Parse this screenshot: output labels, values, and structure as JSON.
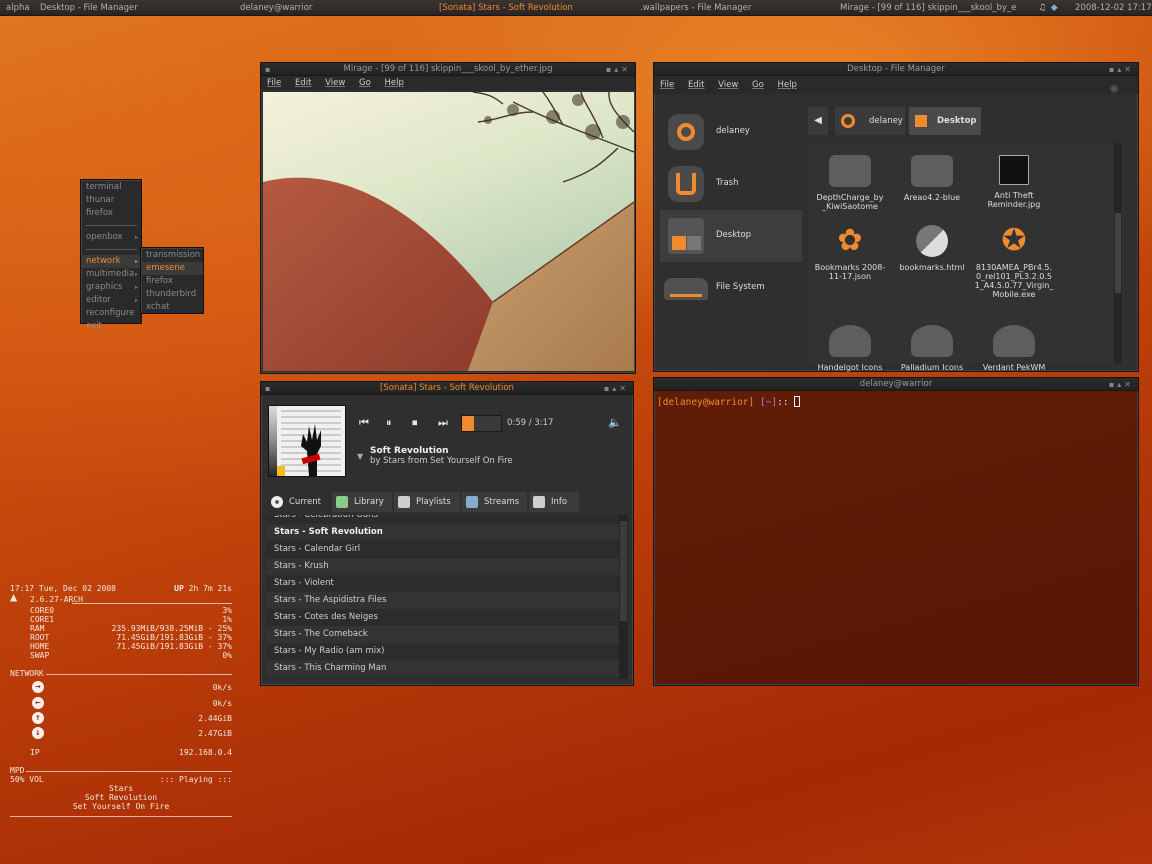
{
  "top_panel": {
    "desktop_name": "alpha",
    "tasks": [
      "Desktop - File Manager",
      "delaney@warrior",
      "[Sonata] Stars - Soft Revolution",
      ".wallpapers - File Manager",
      "Mirage - [99 of 116] skippin___skool_by_e"
    ],
    "active_task_index": 2,
    "tray_icons": [
      "music-note-icon",
      "network-icon"
    ],
    "clock": "2008-12-02 17:17"
  },
  "openbox_menu": {
    "items": [
      {
        "label": "terminal",
        "submenu": false
      },
      {
        "label": "thunar",
        "submenu": false
      },
      {
        "label": "firefox",
        "submenu": false
      },
      {
        "label": "openbox",
        "submenu": true
      },
      {
        "label": "network",
        "submenu": true
      },
      {
        "label": "multimedia",
        "submenu": true
      },
      {
        "label": "graphics",
        "submenu": true
      },
      {
        "label": "editor",
        "submenu": true
      },
      {
        "label": "reconfigure",
        "submenu": false
      },
      {
        "label": "exit",
        "submenu": false
      }
    ],
    "highlighted": "network",
    "submenu": {
      "items": [
        "transmission",
        "emesene",
        "firefox",
        "thunderbird",
        "xchat"
      ],
      "highlighted": "emesene"
    }
  },
  "mirage": {
    "title": "Mirage - [99 of 116] skippin___skool_by_ether.jpg",
    "menu": [
      "File",
      "Edit",
      "View",
      "Go",
      "Help"
    ]
  },
  "file_manager": {
    "title": "Desktop - File Manager",
    "menu": [
      "File",
      "Edit",
      "View",
      "Go",
      "Help"
    ],
    "sidebar": [
      "delaney",
      "Trash",
      "Desktop",
      "File System"
    ],
    "sidebar_selected": "Desktop",
    "breadcrumb": [
      "delaney",
      "Desktop"
    ],
    "files": [
      {
        "name": "DepthCharge_by _KiwiSaotome",
        "icon": "folder-icon"
      },
      {
        "name": "Areao4.2-blue",
        "icon": "folder-icon"
      },
      {
        "name": "Anti Theft Reminder.jpg",
        "icon": "image-icon"
      },
      {
        "name": "Bookmarks 2008-11-17.json",
        "icon": "flower-icon"
      },
      {
        "name": "bookmarks.html",
        "icon": "html-icon"
      },
      {
        "name": "8130AMEA_PBr4.5.0_rel101_PL3.2.0.51_A4.5.0.77_Virgin_Mobile.exe",
        "icon": "star-icon"
      },
      {
        "name": "Handelgot Icons",
        "icon": "folder-icon"
      },
      {
        "name": "Palladium Icons",
        "icon": "folder-icon"
      },
      {
        "name": "Verdant PekWM",
        "icon": "folder-icon"
      }
    ]
  },
  "sonata": {
    "title": "[Sonata] Stars - Soft Revolution",
    "elapsed": "0:59",
    "separator": "/",
    "total": "3:17",
    "progress_fraction": 0.3,
    "song": "Soft Revolution",
    "byline": "by Stars from Set Yourself On Fire",
    "tabs": [
      "Current",
      "Library",
      "Playlists",
      "Streams",
      "Info"
    ],
    "selected_tab": "Current",
    "playlist": [
      "Stars - Celebration Guns",
      "Stars - Soft Revolution",
      "Stars - Calendar Girl",
      "Stars - Krush",
      "Stars - Violent",
      "Stars - The Aspidistra Files",
      "Stars - Cotes des Neiges",
      "Stars - The Comeback",
      "Stars - My Radio (am mix)",
      "Stars - This Charming Man"
    ],
    "current_index": 1
  },
  "terminal": {
    "title": "delaney@warrior",
    "prompt_user": "[delaney@warrior]",
    "prompt_dir": "[~]",
    "prompt_tail": "::"
  },
  "conky": {
    "time": "17:17",
    "date": "Tue, Dec 02 2008",
    "uptime_label": "UP",
    "uptime": "2h 7m 21s",
    "kernel": "2.6.27-ARCH",
    "stats": [
      {
        "label": "CORE0",
        "value": "3%"
      },
      {
        "label": "CORE1",
        "value": "1%"
      },
      {
        "label": "RAM",
        "value": "235.93MiB/938.25MiB - 25%"
      },
      {
        "label": "ROOT",
        "value": "71.45GiB/191.83GiB - 37%"
      },
      {
        "label": "HOME",
        "value": "71.45GiB/191.83GiB - 37%"
      },
      {
        "label": "SWAP",
        "value": "0%"
      }
    ],
    "network_label": "NETWORK",
    "net": [
      {
        "icon": "arrow-right-icon",
        "value": "0k/s"
      },
      {
        "icon": "arrow-left-icon",
        "value": "0k/s"
      },
      {
        "icon": "arrow-up-icon",
        "value": "2.44GiB"
      },
      {
        "icon": "arrow-down-icon",
        "value": "2.47GiB"
      }
    ],
    "ip_label": "IP",
    "ip": "192.168.0.4",
    "mpd_label": "MPD",
    "volume": "50% VOL",
    "mpd_status": "::: Playing :::",
    "artist": "Stars",
    "song": "Soft Revolution",
    "album": "Set Yourself On Fire"
  }
}
